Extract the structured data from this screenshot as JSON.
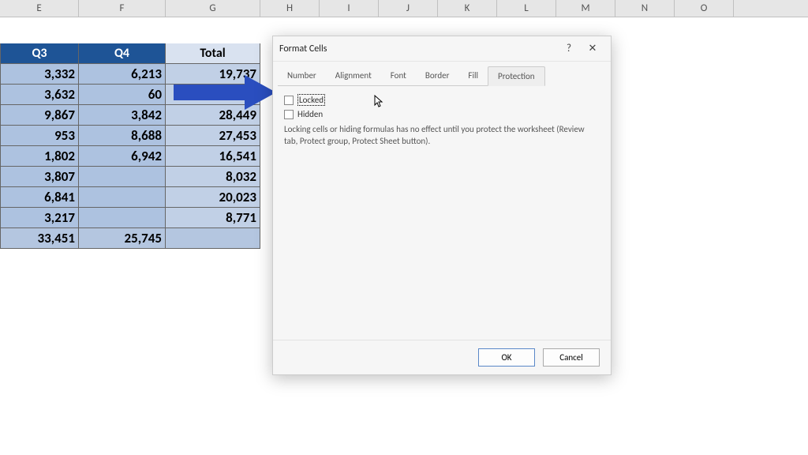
{
  "columns": [
    "E",
    "F",
    "G",
    "H",
    "I",
    "J",
    "K",
    "L",
    "M",
    "N",
    "O"
  ],
  "table": {
    "headers": {
      "e": "Q3",
      "f": "Q4",
      "g": "Total"
    },
    "rows": [
      {
        "e": "3,332",
        "f": "6,213",
        "g": "19,737"
      },
      {
        "e": "3,632",
        "f": "60",
        "g": ""
      },
      {
        "e": "9,867",
        "f": "3,842",
        "g": "28,449"
      },
      {
        "e": "953",
        "f": "8,688",
        "g": "27,453"
      },
      {
        "e": "1,802",
        "f": "6,942",
        "g": "16,541"
      },
      {
        "e": "3,807",
        "f": "",
        "g": "8,032"
      },
      {
        "e": "6,841",
        "f": "",
        "g": "20,023"
      },
      {
        "e": "3,217",
        "f": "",
        "g": "8,771"
      }
    ],
    "totals": {
      "e": "33,451",
      "f": "25,745",
      "g": ""
    }
  },
  "dialog": {
    "title": "Format Cells",
    "help": "?",
    "close": "✕",
    "tabs": {
      "number": "Number",
      "alignment": "Alignment",
      "font": "Font",
      "border": "Border",
      "fill": "Fill",
      "protection": "Protection"
    },
    "active_tab": "protection",
    "locked_label": "Locked",
    "hidden_label": "Hidden",
    "description": "Locking cells or hiding formulas has no effect until you protect the worksheet (Review tab, Protect group, Protect Sheet button).",
    "ok": "OK",
    "cancel": "Cancel"
  }
}
